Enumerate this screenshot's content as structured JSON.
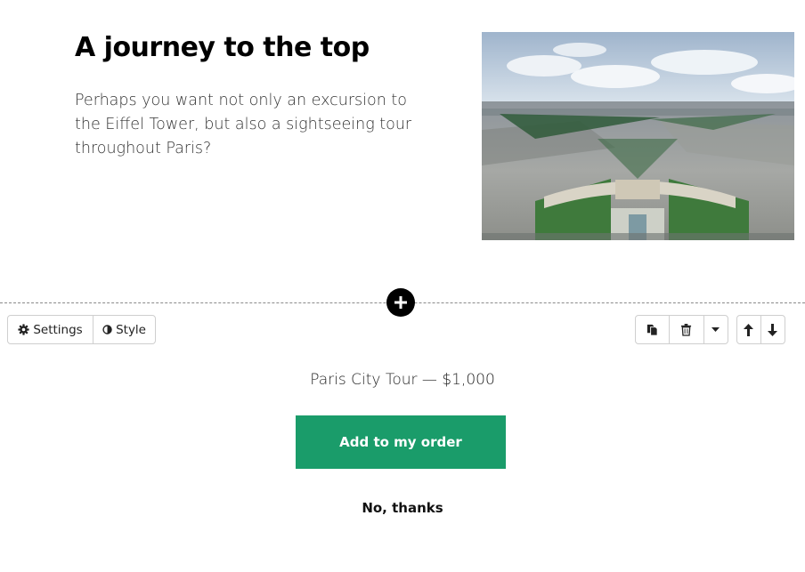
{
  "hero": {
    "title": "A journey to the top",
    "text": "Perhaps you want not only an excursion to the Eiffel Tower, but also a sightseeing tour throughout Paris?",
    "image_icon": "paris-aerial-photo"
  },
  "editor": {
    "add_icon": "plus-icon",
    "settings_label": "Settings",
    "settings_icon": "gear-icon",
    "style_label": "Style",
    "style_icon": "contrast-icon",
    "duplicate_icon": "duplicate-icon",
    "delete_icon": "trash-icon",
    "more_icon": "caret-down-icon",
    "move_up_icon": "arrow-up-icon",
    "move_down_icon": "arrow-down-icon"
  },
  "offer": {
    "line": "Paris City Tour — $1,000",
    "accept_label": "Add to my order",
    "decline_label": "No, thanks",
    "accent_color": "#1a9c6a"
  }
}
